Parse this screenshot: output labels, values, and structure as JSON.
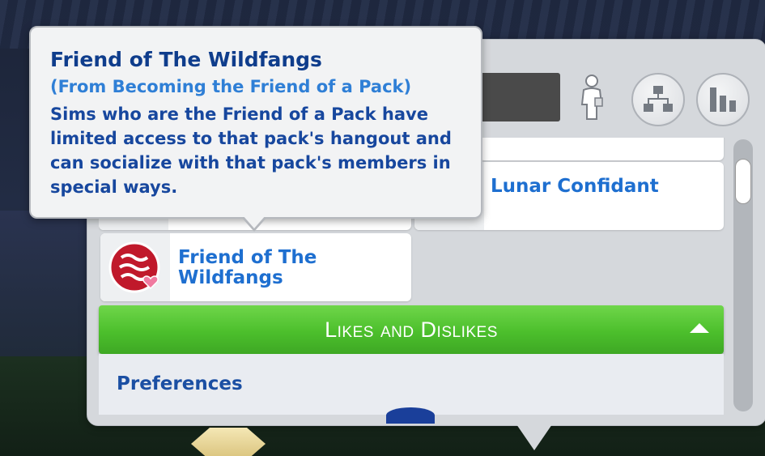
{
  "tooltip": {
    "title": "Friend of The Wildfangs",
    "source": "(From Becoming the Friend of a Pack)",
    "description": "Sims who are the Friend of a Pack have limited access to that pack's hangout and can socialize with that pack's members in special ways."
  },
  "toolbar": {
    "sim_icon": "sim-figure-icon",
    "tree_button_icon": "family-tree-icon",
    "stats_button_icon": "bar-chart-icon"
  },
  "rewards": [
    {
      "label": "Lunar Confidant",
      "icon": "lunar-confidant-icon"
    },
    {
      "label": "Friend of The Wildfangs",
      "icon": "wildfangs-icon"
    }
  ],
  "likes_section": {
    "label": "Likes and Dislikes"
  },
  "preferences": {
    "label": "Preferences"
  },
  "colors": {
    "accent_green": "#4cbf2c",
    "title_blue": "#0f3d8c",
    "link_blue": "#1e6fd0",
    "wildfangs_red": "#c0192b"
  }
}
